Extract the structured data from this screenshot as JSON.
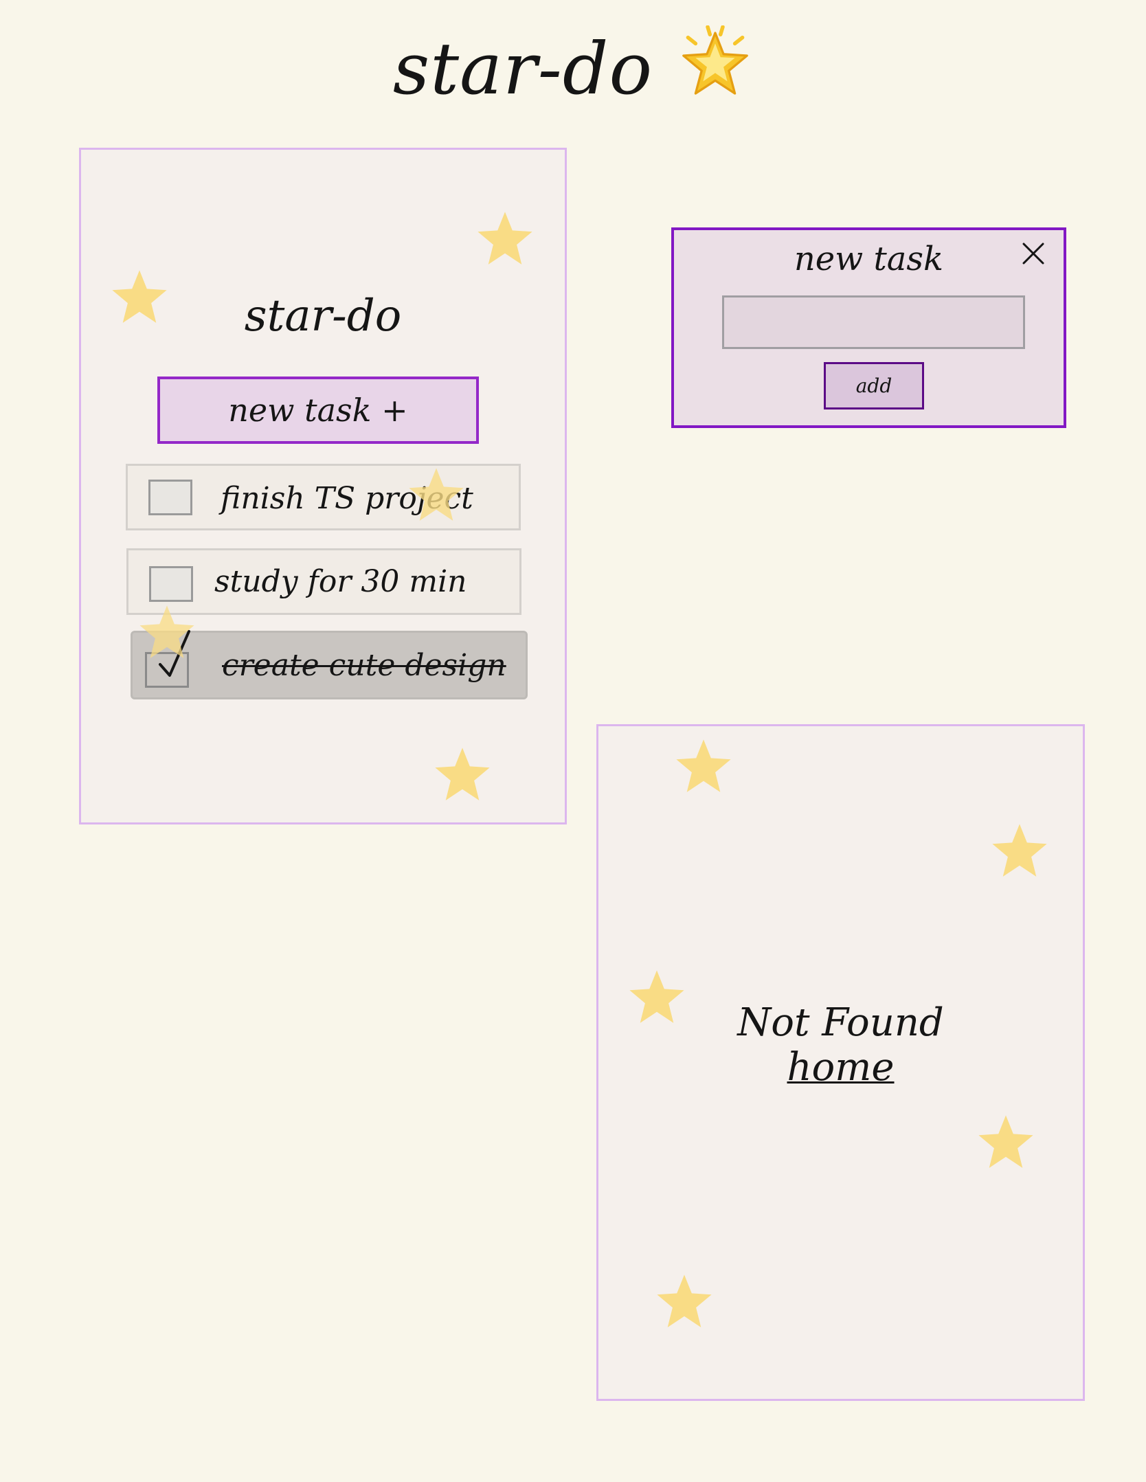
{
  "header": {
    "title": "star-do",
    "title_icon": "glowing-star-icon"
  },
  "app_screen": {
    "title": "star-do",
    "new_task_button": "new task +",
    "tasks": [
      {
        "label": "finish TS project",
        "done": false
      },
      {
        "label": "study for 30 min",
        "done": false
      },
      {
        "label": "create cute design",
        "done": true
      }
    ]
  },
  "modal": {
    "title": "new task",
    "input_value": "",
    "input_placeholder": "",
    "add_label": "add",
    "close_icon": "close-icon"
  },
  "not_found": {
    "message": "Not Found",
    "link_label": "home"
  },
  "colors": {
    "background": "#f9f6ea",
    "frame_border": "#dcb6ee",
    "accent_purple": "#8218c4",
    "button_fill": "#e8d5e8",
    "star": "#f9dc85"
  }
}
